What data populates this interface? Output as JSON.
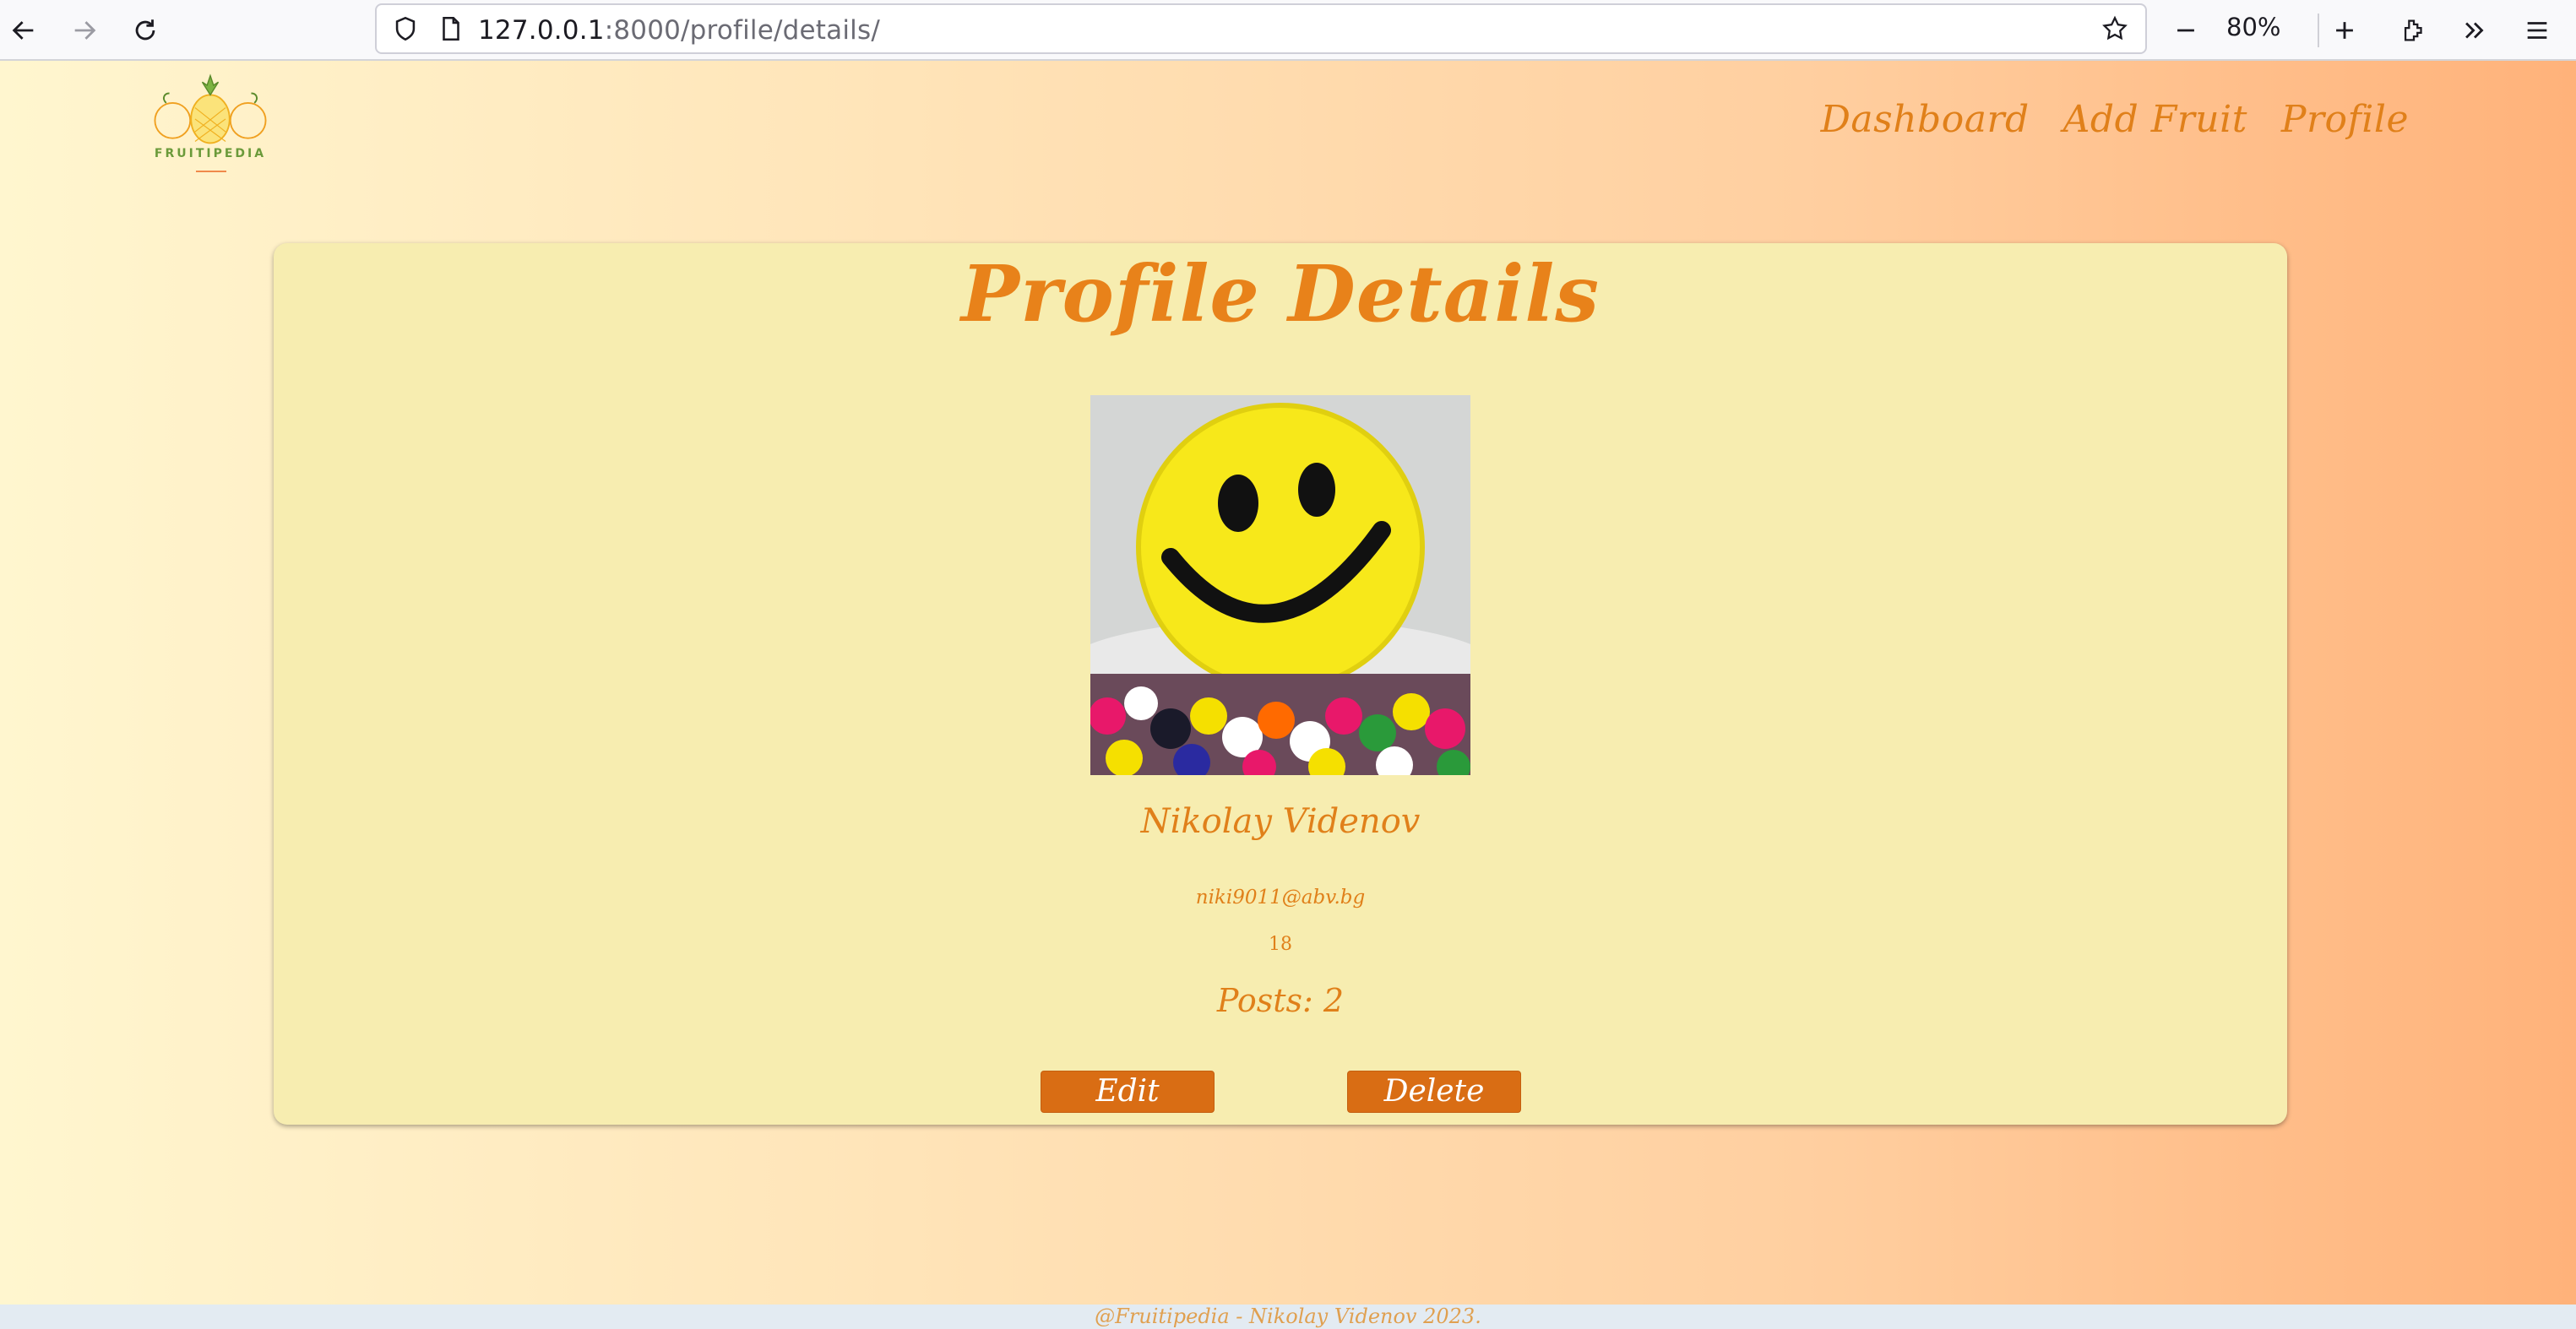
{
  "browser": {
    "url_host": "127.0.0.1",
    "url_rest": ":8000/profile/details/",
    "zoom": "80%",
    "icons": [
      "back-arrow-icon",
      "forward-arrow-icon",
      "reload-icon",
      "shield-icon",
      "page-icon",
      "star-icon",
      "zoom-out-icon",
      "zoom-in-icon",
      "extensions-icon",
      "overflow-icon",
      "menu-icon"
    ]
  },
  "header": {
    "logo_text": "FRUITIPEDIA",
    "nav": [
      "Dashboard",
      "Add Fruit",
      "Profile"
    ]
  },
  "profile": {
    "title": "Profile Details",
    "name": "Nikolay Videnov",
    "email": "niki9011@abv.bg",
    "age": "18",
    "posts": "Posts: 2",
    "edit_label": "Edit",
    "delete_label": "Delete"
  },
  "footer": {
    "text": "@Fruitipedia - Nikolay Videnov 2023."
  },
  "colors": {
    "accent": "#e0801a",
    "button": "#d96d14",
    "card": "#f7edb0"
  }
}
